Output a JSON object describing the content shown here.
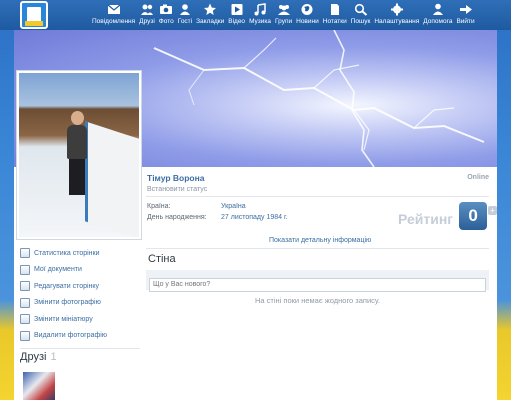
{
  "nav": [
    {
      "label": "Повідомлення",
      "icon": "envelope-icon"
    },
    {
      "label": "Друзі",
      "icon": "friends-icon"
    },
    {
      "label": "Фото",
      "icon": "camera-icon"
    },
    {
      "label": "Гості",
      "icon": "guests-icon"
    },
    {
      "label": "Закладки",
      "icon": "star-icon"
    },
    {
      "label": "Відео",
      "icon": "play-icon"
    },
    {
      "label": "Музика",
      "icon": "music-note-icon"
    },
    {
      "label": "Групи",
      "icon": "groups-icon"
    },
    {
      "label": "Новини",
      "icon": "globe-icon"
    },
    {
      "label": "Нотатки",
      "icon": "note-icon"
    },
    {
      "label": "Пошук",
      "icon": "search-icon"
    },
    {
      "label": "Налаштування",
      "icon": "gear-icon"
    },
    {
      "label": "Допомога",
      "icon": "help-person-icon"
    },
    {
      "label": "Вийти",
      "icon": "exit-arrow-icon"
    }
  ],
  "profile": {
    "name": "Тімур Ворона",
    "online": "Online",
    "set_status": "Встановити статус",
    "country_label": "Країна:",
    "country_value": "Україна",
    "birthday_label": "День народження:",
    "birthday_value": "27 листопаду 1984 г.",
    "rating_label": "Рейтинг",
    "rating_value": "0",
    "rating_plus": "+",
    "details_link": "Показати детальну інформацію"
  },
  "menu": [
    {
      "label": "Статистика сторінки"
    },
    {
      "label": "Мої документи"
    },
    {
      "label": "Редагувати сторінку"
    },
    {
      "label": "Змінити фотографію"
    },
    {
      "label": "Змінити мініатюру"
    },
    {
      "label": "Видалити фотографію"
    }
  ],
  "wall": {
    "title": "Стіна",
    "placeholder": "Що у Вас нового?",
    "empty": "На стіні поки немає жодного запису."
  },
  "friends": {
    "title": "Друзі",
    "count": "1"
  },
  "colors": {
    "link": "#3b6ea5",
    "topbar": "#1f5aa0",
    "rating": "#2c5f97"
  }
}
